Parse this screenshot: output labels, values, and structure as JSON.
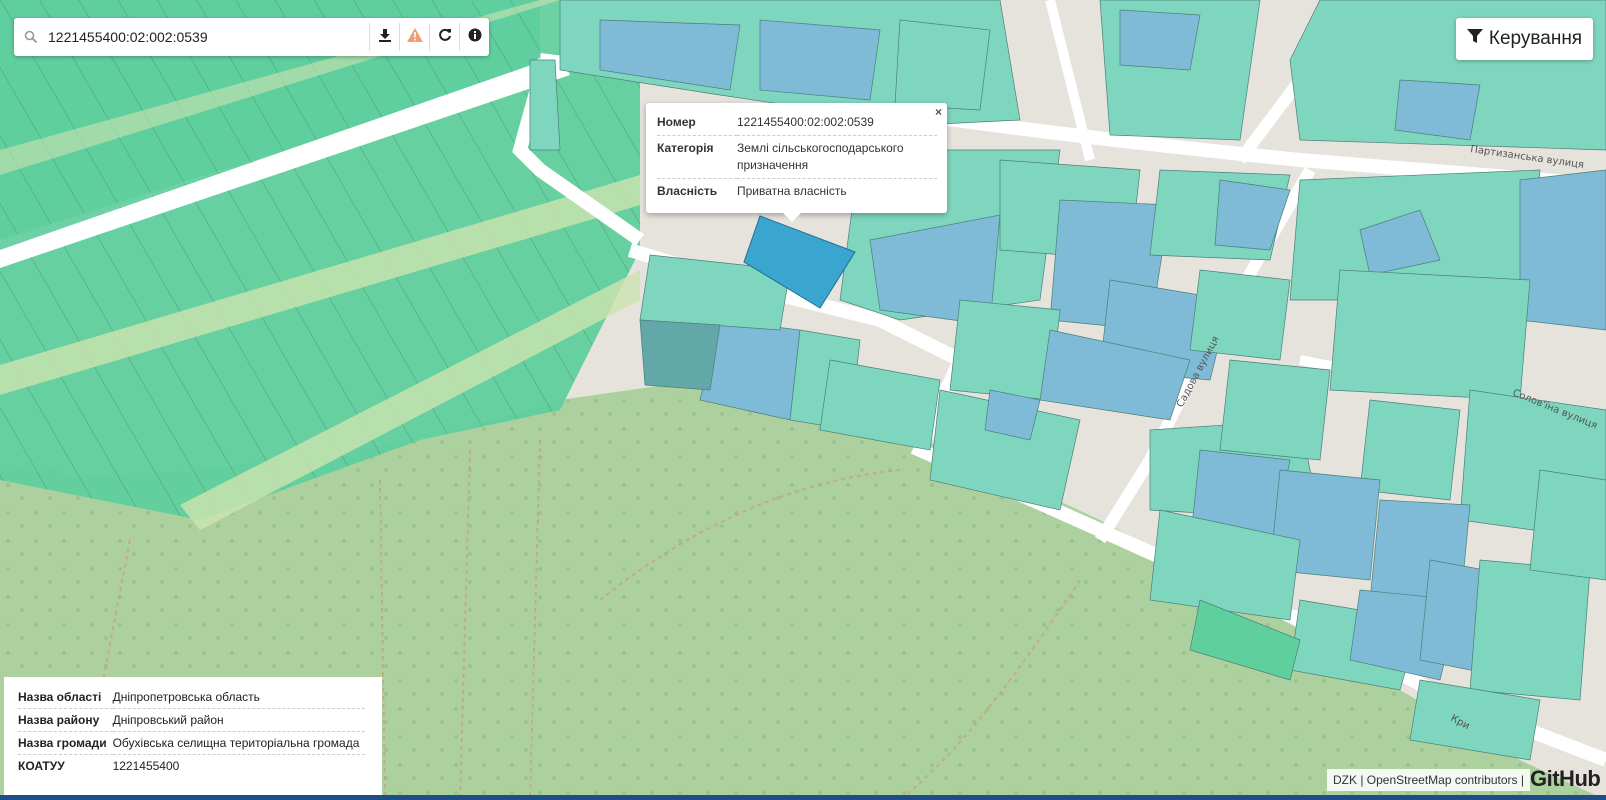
{
  "search": {
    "value": "1221455400:02:002:0539",
    "buttons": [
      {
        "name": "download-icon"
      },
      {
        "name": "warning-icon"
      },
      {
        "name": "refresh-icon"
      },
      {
        "name": "info-icon"
      }
    ]
  },
  "control": {
    "label": "Керування",
    "icon": "filter-icon"
  },
  "popup": {
    "close": "×",
    "rows": [
      {
        "key": "Номер",
        "value": "1221455400:02:002:0539"
      },
      {
        "key": "Категорія",
        "value": "Землі сільськогосподарського призначення"
      },
      {
        "key": "Власність",
        "value": "Приватна власність"
      }
    ]
  },
  "info": {
    "rows": [
      {
        "key": "Назва області",
        "value": "Дніпропетровська область"
      },
      {
        "key": "Назва району",
        "value": "Дніпровський район"
      },
      {
        "key": "Назва громади",
        "value": "Обухівська селищна територіальна громада"
      },
      {
        "key": "КОАТУУ",
        "value": "1221455400"
      }
    ]
  },
  "map": {
    "streets": [
      "Партизанська вулиця",
      "Садова вулиця",
      "Солов'їна вулиця",
      "Кри"
    ],
    "colors": {
      "base": "#e6e2dc",
      "forest": "#add19e",
      "parcel_green": "#5fcf9e",
      "parcel_teal": "#7fd6be",
      "parcel_blue": "#7fbad6",
      "selected": "#3aa6d0"
    }
  },
  "attribution": {
    "text": "DZK | OpenStreetMap contributors |",
    "github": "GitHub"
  }
}
